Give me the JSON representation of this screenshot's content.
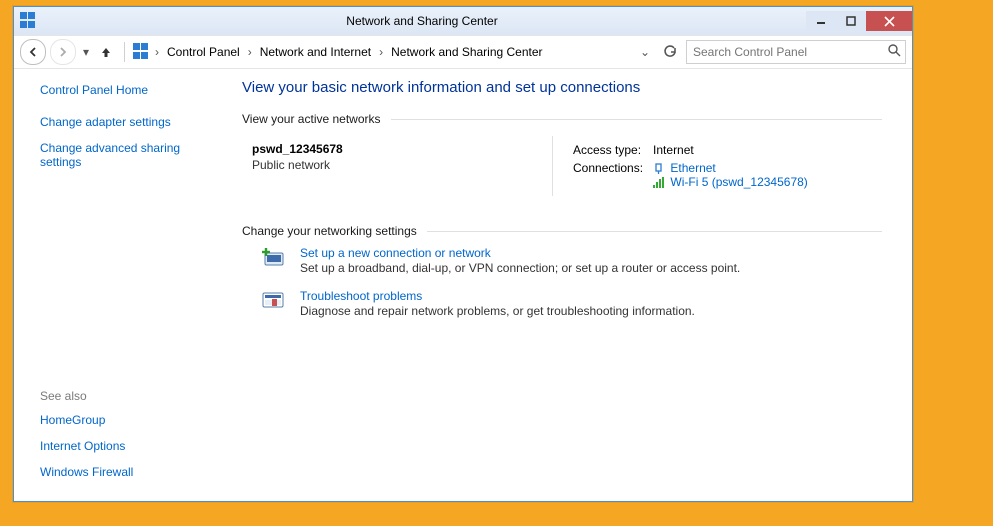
{
  "window": {
    "title": "Network and Sharing Center"
  },
  "breadcrumbs": {
    "items": [
      "Control Panel",
      "Network and Internet",
      "Network and Sharing Center"
    ]
  },
  "search": {
    "placeholder": "Search Control Panel"
  },
  "sidebar": {
    "home": "Control Panel Home",
    "links": [
      "Change adapter settings",
      "Change advanced sharing settings"
    ],
    "see_also_heading": "See also",
    "see_also": [
      "HomeGroup",
      "Internet Options",
      "Windows Firewall"
    ]
  },
  "main": {
    "title": "View your basic network information and set up connections",
    "active_heading": "View your active networks",
    "network": {
      "name": "pswd_12345678",
      "type": "Public network",
      "access_label": "Access type:",
      "access_value": "Internet",
      "connections_label": "Connections:",
      "conn1": "Ethernet",
      "conn2": "Wi-Fi 5 (pswd_12345678)"
    },
    "change_heading": "Change your networking settings",
    "setup": {
      "title": "Set up a new connection or network",
      "desc": "Set up a broadband, dial-up, or VPN connection; or set up a router or access point."
    },
    "troubleshoot": {
      "title": "Troubleshoot problems",
      "desc": "Diagnose and repair network problems, or get troubleshooting information."
    }
  }
}
